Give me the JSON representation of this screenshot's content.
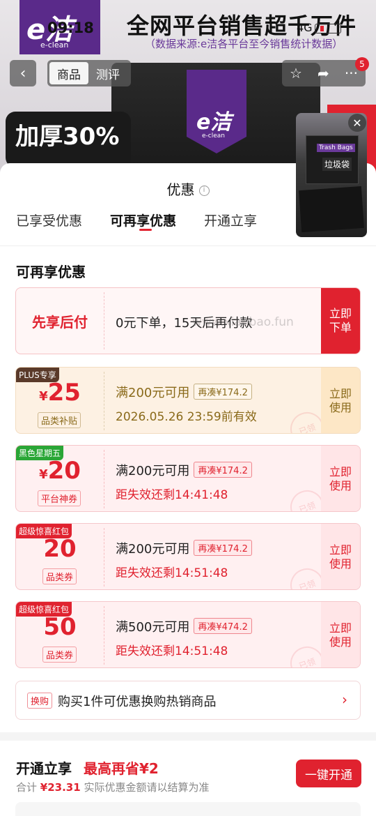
{
  "status": {
    "time": "09:18",
    "network": "4G"
  },
  "background": {
    "logo_main": "e洁",
    "logo_sub": "e-clean",
    "headline": "全网平台销售超千万件",
    "source": "（数据来源:e洁各平台至今销售统计数据）",
    "thick_line1": "加厚30%",
    "thick_line2": "",
    "product_logo": "e洁",
    "product_logo_sub": "e-clean"
  },
  "nav": {
    "back_icon": "chevron-left-icon",
    "tabs": [
      {
        "label": "商品",
        "active": true
      },
      {
        "label": "测评",
        "active": false
      }
    ],
    "badge_count": "5"
  },
  "float_video": {
    "tag": "Trash Bags",
    "label": "垃圾袋"
  },
  "sheet": {
    "title": "优惠",
    "tabs": [
      {
        "label": "已享受优惠",
        "active": false
      },
      {
        "label": "可再享优惠",
        "active": true
      },
      {
        "label": "开通立享",
        "active": false
      }
    ],
    "section_title": "可再享优惠",
    "pay_later": {
      "title": "先享后付",
      "desc": "0元下单，15天后再付款",
      "cta": "立即下单"
    },
    "watermark": "www.xianbao.fun",
    "coupons": [
      {
        "badge": "PLUS专享",
        "badge_color": "#5a3a2a",
        "yen": "¥",
        "amount": "25",
        "kind": "品类补贴",
        "condition": "满200元可用",
        "tag": "再凑¥174.2",
        "sub": "2026.05.26 23:59前有效",
        "cta": "立即使用",
        "stamp": "已领"
      },
      {
        "badge": "黑色星期五",
        "badge_color": "#2aa636",
        "yen": "¥",
        "amount": "20",
        "kind": "平台神券",
        "condition": "满200元可用",
        "tag": "再凑¥174.2",
        "sub": "距失效还剩14:41:48",
        "cta": "立即使用",
        "stamp": "已领"
      },
      {
        "badge": "超级惊喜红包",
        "badge_color": "#e0222f",
        "yen": "",
        "amount": "20",
        "kind": "品类券",
        "condition": "满200元可用",
        "tag": "再凑¥174.2",
        "sub": "距失效还剩14:51:48",
        "cta": "立即使用",
        "stamp": "已领"
      },
      {
        "badge": "超级惊喜红包",
        "badge_color": "#e0222f",
        "yen": "",
        "amount": "50",
        "kind": "品类券",
        "condition": "满500元可用",
        "tag": "再凑¥474.2",
        "sub": "距失效还剩14:51:48",
        "cta": "立即使用",
        "stamp": "已领"
      }
    ],
    "swap": {
      "tag": "换购",
      "text": "购买1件可优惠换购热销商品"
    },
    "open": {
      "title": "开通立享",
      "save": "最高再省¥2",
      "sub_prefix": "合计",
      "sub_amount": "¥23.31",
      "sub_suffix": "实际优惠金额请以结算为准",
      "button": "一键开通"
    }
  },
  "colors": {
    "accent": "#e0222f",
    "plus_gold": "#8a6a1a",
    "plus_bg": "#fdf1e3"
  }
}
